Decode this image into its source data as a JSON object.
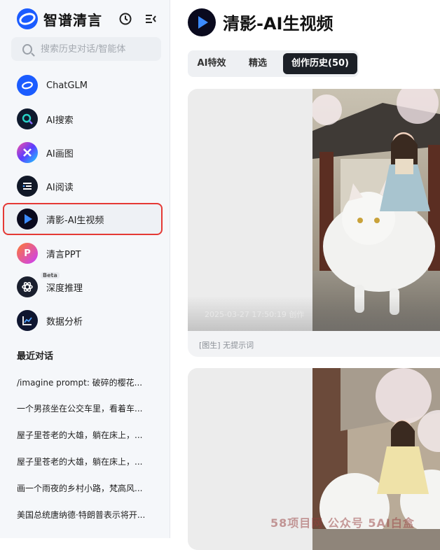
{
  "sidebar": {
    "brand": "智谱清言",
    "search_placeholder": "搜索历史对话/智能体",
    "nav": [
      {
        "label": "ChatGLM",
        "icon": "chatglm-icon"
      },
      {
        "label": "AI搜索",
        "icon": "ai-search-icon"
      },
      {
        "label": "AI画图",
        "icon": "ai-draw-icon"
      },
      {
        "label": "AI阅读",
        "icon": "ai-read-icon"
      },
      {
        "label": "清影-AI生视频",
        "icon": "qingying-icon",
        "selected": true
      },
      {
        "label": "清言PPT",
        "icon": "ppt-icon"
      },
      {
        "label": "深度推理",
        "icon": "reasoning-icon",
        "badge": "Beta"
      },
      {
        "label": "数据分析",
        "icon": "data-analysis-icon"
      }
    ],
    "recent_title": "最近对话",
    "recent": [
      "/imagine prompt: 破碎的樱花...",
      "一个男孩坐在公交车里，看着车...",
      "屋子里苍老的大雄，躺在床上，...",
      "屋子里苍老的大雄，躺在床上，...",
      "画一个雨夜的乡村小路，梵高风...",
      "美国总统唐纳德·特朗普表示将开..."
    ]
  },
  "main": {
    "title": "清影-AI生视频",
    "tabs": [
      {
        "label": "AI特效"
      },
      {
        "label": "精选"
      },
      {
        "label": "创作历史(50)",
        "active": true
      }
    ],
    "cards": [
      {
        "timestamp": "2025-03-27 17:50:19  创作",
        "caption": "[图生] 无提示词"
      },
      {
        "timestamp": "",
        "caption": ""
      }
    ]
  },
  "watermark": "58项目网 公众号 5AI白盒",
  "colors": {
    "accent": "#1b5cff",
    "selected_border": "#e53935",
    "active_tab": "#1c2027"
  }
}
